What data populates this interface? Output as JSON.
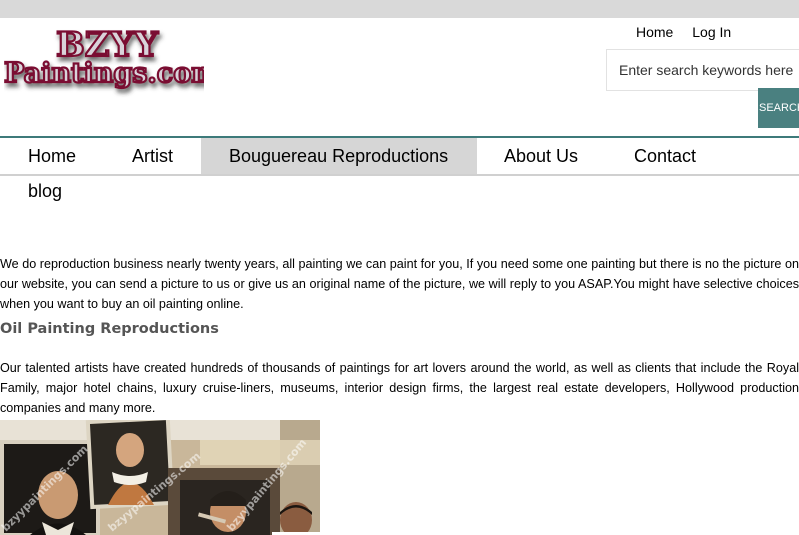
{
  "header": {
    "logo_line1": "BZYY",
    "logo_line2": "Paintings.com",
    "user_nav": [
      "Home",
      "Log In"
    ],
    "search": {
      "placeholder": "Enter search keywords here",
      "button": "SEARCH"
    }
  },
  "main_nav": {
    "items": [
      "Home",
      "Artist",
      "Bouguereau Reproductions",
      "About Us",
      "Contact",
      "blog"
    ],
    "active": "Bouguereau Reproductions"
  },
  "content": {
    "intro": "We do reproduction business nearly twenty years, all painting we can paint for you, If you need some one painting but there is no the picture on our website, you can send a picture to us or give us an original name of the picture, we will reply to you ASAP.You might have selective choices when you want to buy an oil painting online.",
    "section_title": "Oil Painting Reproductions",
    "body": "Our talented artists have created hundreds of thousands of paintings for art lovers around the world, as well as clients that include the Royal Family, major hotel chains, luxury cruise-liners, museums, interior design firms, the largest real estate developers, Hollywood production companies and many more.",
    "watermark": "bzyypaintings.com"
  },
  "colors": {
    "nav_border": "#3d7a7a",
    "search_button": "#4a8080",
    "logo_fill": "#d9d3da",
    "logo_outline": "#7a1030",
    "active_nav_bg": "#d6d6d6"
  }
}
